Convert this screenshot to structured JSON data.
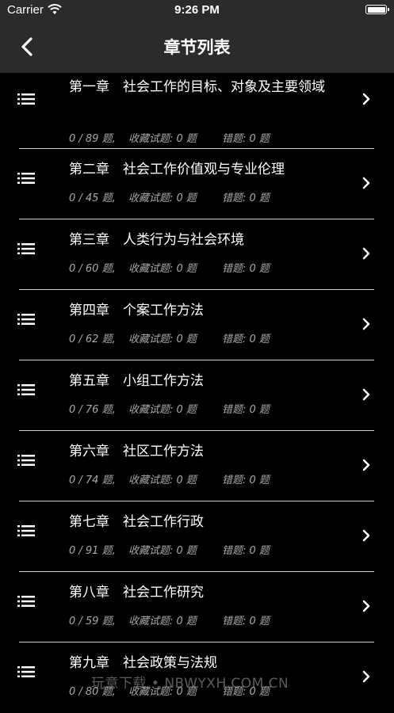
{
  "status_bar": {
    "carrier": "Carrier",
    "time": "9:26 PM"
  },
  "nav": {
    "title": "章节列表",
    "back_icon": "chevron-left-icon"
  },
  "chapters": [
    {
      "title": "第一章　社会工作的目标、对象及主要领域",
      "progress": "0 / 89 题,",
      "favorites": "收藏试题: 0 题",
      "errors": "错题: 0 题"
    },
    {
      "title": "第二章　社会工作价值观与专业伦理",
      "progress": "0 / 45 题,",
      "favorites": "收藏试题: 0 题",
      "errors": "错题: 0 题"
    },
    {
      "title": "第三章　人类行为与社会环境",
      "progress": "0 / 60 题,",
      "favorites": "收藏试题: 0 题",
      "errors": "错题: 0 题"
    },
    {
      "title": "第四章　个案工作方法",
      "progress": "0 / 62 题,",
      "favorites": "收藏试题: 0 题",
      "errors": "错题: 0 题"
    },
    {
      "title": "第五章　小组工作方法",
      "progress": "0 / 76 题,",
      "favorites": "收藏试题: 0 题",
      "errors": "错题: 0 题"
    },
    {
      "title": "第六章　社区工作方法",
      "progress": "0 / 74 题,",
      "favorites": "收藏试题: 0 题",
      "errors": "错题: 0 题"
    },
    {
      "title": "第七章　社会工作行政",
      "progress": "0 / 91 题,",
      "favorites": "收藏试题: 0 题",
      "errors": "错题: 0 题"
    },
    {
      "title": "第八章　社会工作研究",
      "progress": "0 / 59 题,",
      "favorites": "收藏试题: 0 题",
      "errors": "错题: 0 题"
    },
    {
      "title": "第九章　社会政策与法规",
      "progress": "0 / 80 题,",
      "favorites": "收藏试题: 0 题",
      "errors": "错题: 0 题"
    }
  ],
  "watermark": "玩意下载 • NBWYXH.COM.CN",
  "colors": {
    "background": "#000000",
    "bar": "#2b2b2b",
    "meta_text": "#a8a8a8",
    "divider": "#d0d0d0"
  }
}
